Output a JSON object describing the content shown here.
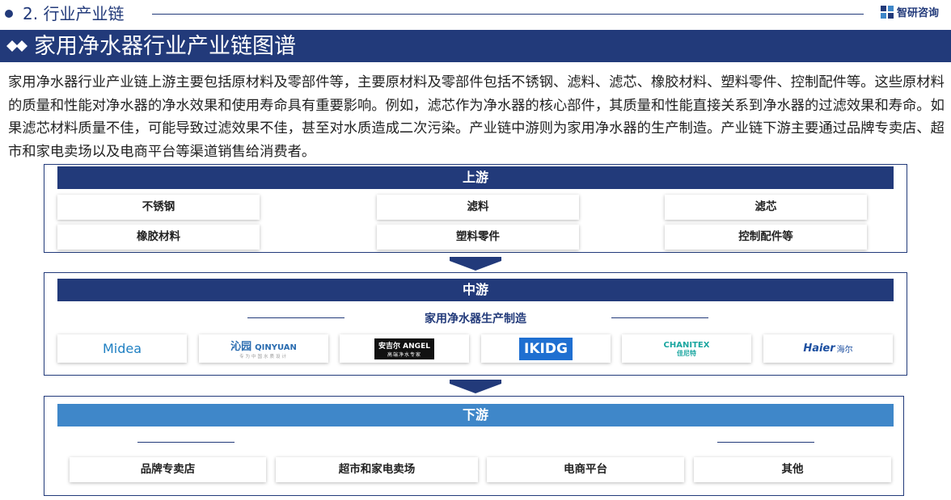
{
  "header": {
    "section_title": "2. 行业产业链",
    "company": "智研咨询"
  },
  "title": "家用净水器行业产业链图谱",
  "description": "家用净水器行业产业链上游主要包括原材料及零部件等，主要原材料及零部件包括不锈钢、滤料、滤芯、橡胶材料、塑料零件、控制配件等。这些原材料的质量和性能对净水器的净水效果和使用寿命具有重要影响。例如，滤芯作为净水器的核心部件，其质量和性能直接关系到净水器的过滤效果和寿命。如果滤芯材料质量不佳，可能导致过滤效果不佳，甚至对水质造成二次污染。产业链中游则为家用净水器的生产制造。产业链下游主要通过品牌专卖店、超市和家电卖场以及电商平台等渠道销售给消费者。",
  "upstream": {
    "label": "上游",
    "items": [
      "不锈钢",
      "滤料",
      "滤芯",
      "橡胶材料",
      "塑料零件",
      "控制配件等"
    ]
  },
  "midstream": {
    "label": "中游",
    "subtitle": "家用净水器生产制造",
    "brands": [
      {
        "text": "Midea"
      },
      {
        "text": "沁园",
        "text2": "QINYUAN",
        "text3": "专为中国水质设计"
      },
      {
        "text": "安吉尔 ANGEL",
        "text2": "高端净水专家"
      },
      {
        "text": "IKIDG"
      },
      {
        "text": "CHANITEX",
        "text2": "佳尼特"
      },
      {
        "text": "Haier",
        "text2": "海尔"
      }
    ]
  },
  "downstream": {
    "label": "下游",
    "items": [
      "品牌专卖店",
      "超市和家电卖场",
      "电商平台",
      "其他"
    ]
  },
  "colors": {
    "navy": "#223a7a",
    "light_blue": "#3f87c9",
    "midea_blue": "#1e7fc2",
    "qinyuan_blue": "#2a6cb0",
    "chanitex_teal": "#1aa6a0",
    "ikidg_blue": "#1f6fd1",
    "haier_blue": "#1c4fa0"
  }
}
